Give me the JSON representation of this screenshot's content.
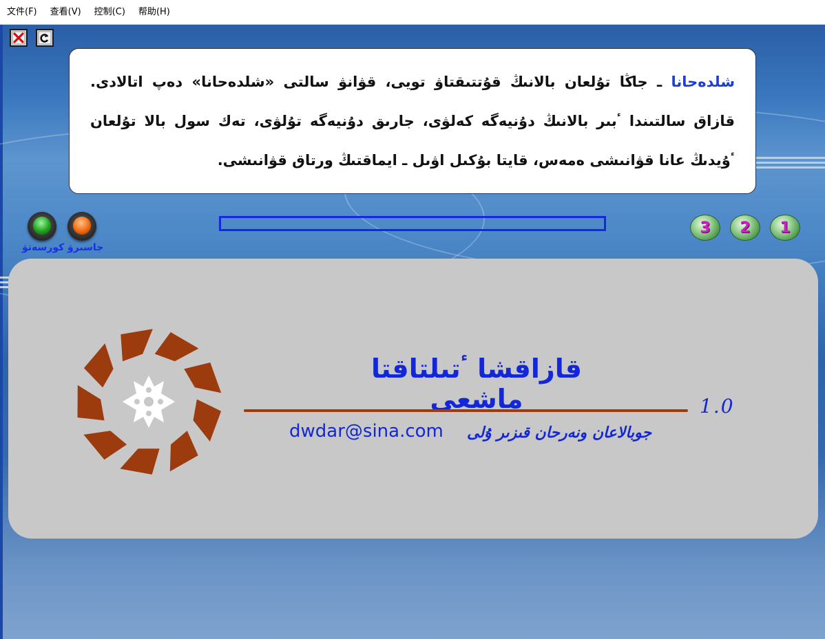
{
  "menu": {
    "items": [
      {
        "label": "文件(F)"
      },
      {
        "label": "查看(V)"
      },
      {
        "label": "控制(C)"
      },
      {
        "label": "帮助(H)"
      }
    ]
  },
  "toolbar": {
    "close_icon": "close-icon",
    "refresh_icon": "refresh-icon"
  },
  "text_box": {
    "first_word": "شلدەحانا",
    "body": " ـ جاڭا تۇلعان بالانىڭ قۇتتىقتاۋ تويى، قۋانۋ سالتى «شلدەحانا» دەپ اتالادى. قازاق سالتىندا ٴبىر بالانىڭ دۇنيەگە كەلۋى، جارىق دۇنيەگە تۇلۋى، تەك سول بالا تۇلعان ٴۇيدىڭ عانا قۋانىشى ەمەس، قايتا بۇكىل اۋىل ـ ايماقتىڭ ورتاق قۋانىشى."
  },
  "controls": {
    "left_button_label": "كورسەتۋ",
    "right_button_label": "جاسىرۋ",
    "left_button_color": "#1fa31f",
    "right_button_color": "#f26a10"
  },
  "progress": {
    "fraction": 0
  },
  "pages": [
    "3",
    "2",
    "1"
  ],
  "splash": {
    "title": "قازاقشا ٴتىلتاقتا ماشعى",
    "version": "1.0",
    "email": "dwdar@sina.com",
    "author": "جوبالاعان ونەرحان قىزىر ۇلى",
    "logo_color": "#9b3b0e"
  }
}
